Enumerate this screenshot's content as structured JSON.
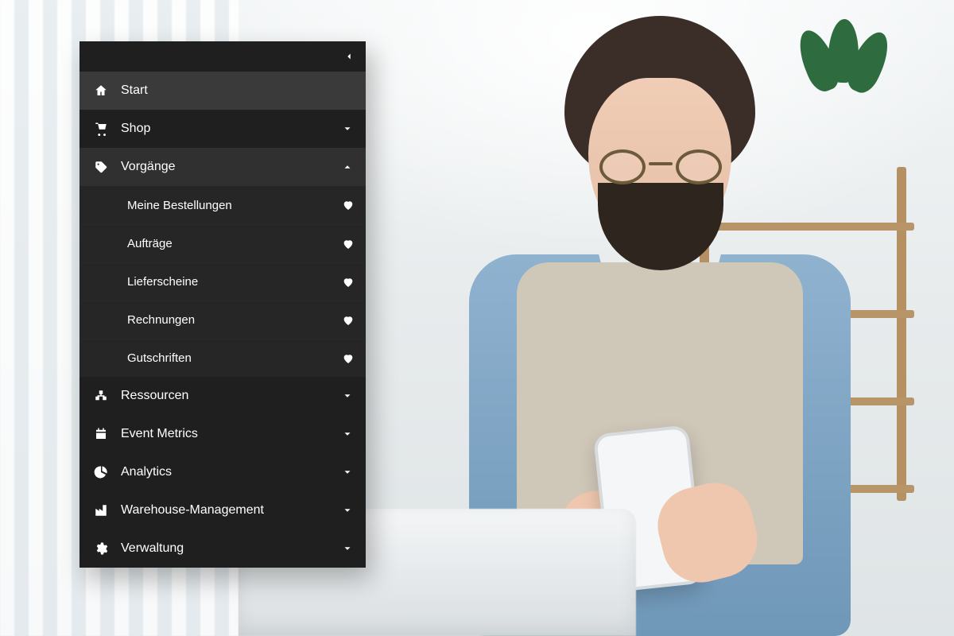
{
  "sidebar": {
    "items": [
      {
        "label": "Start",
        "icon": "home-icon",
        "state": "active",
        "expandable": false
      },
      {
        "label": "Shop",
        "icon": "cart-icon",
        "state": "collapsed",
        "expandable": true
      },
      {
        "label": "Vorgänge",
        "icon": "tag-icon",
        "state": "expanded",
        "expandable": true,
        "children": [
          {
            "label": "Meine Bestellungen",
            "favorite": true
          },
          {
            "label": "Aufträge",
            "favorite": true
          },
          {
            "label": "Lieferscheine",
            "favorite": true
          },
          {
            "label": "Rechnungen",
            "favorite": true
          },
          {
            "label": "Gutschriften",
            "favorite": true
          }
        ]
      },
      {
        "label": "Ressourcen",
        "icon": "boxes-icon",
        "state": "collapsed",
        "expandable": true
      },
      {
        "label": "Event Metrics",
        "icon": "calendar-icon",
        "state": "collapsed",
        "expandable": true
      },
      {
        "label": "Analytics",
        "icon": "pie-icon",
        "state": "collapsed",
        "expandable": true
      },
      {
        "label": "Warehouse-Management",
        "icon": "industry-icon",
        "state": "collapsed",
        "expandable": true
      },
      {
        "label": "Verwaltung",
        "icon": "gear-icon",
        "state": "collapsed",
        "expandable": true
      }
    ]
  }
}
